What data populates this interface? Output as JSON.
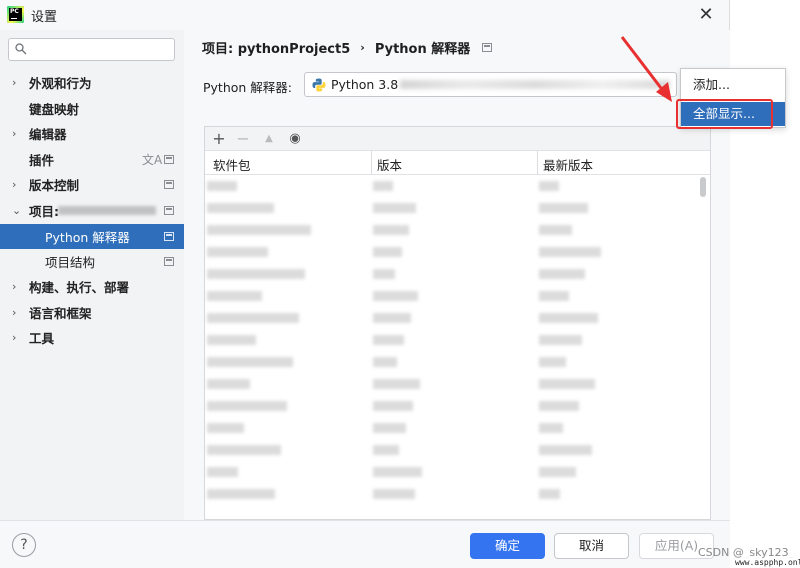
{
  "window": {
    "title": "设置",
    "close_glyph": "✕"
  },
  "search": {
    "placeholder": "",
    "value": ""
  },
  "sidebar": {
    "items": [
      {
        "label": "外观和行为",
        "expandable": true
      },
      {
        "label": "键盘映射",
        "expandable": false
      },
      {
        "label": "编辑器",
        "expandable": true
      },
      {
        "label": "插件",
        "expandable": false
      },
      {
        "label": "版本控制",
        "expandable": true
      },
      {
        "label": "项目:",
        "expandable": true,
        "expanded": true
      },
      {
        "label": "Python 解释器",
        "child": true,
        "selected": true
      },
      {
        "label": "项目结构",
        "child": true
      },
      {
        "label": "构建、执行、部署",
        "expandable": true
      },
      {
        "label": "语言和框架",
        "expandable": true
      },
      {
        "label": "工具",
        "expandable": true
      }
    ]
  },
  "breadcrumb": {
    "project": "项目: pythonProject5",
    "separator": "›",
    "page": "Python 解释器"
  },
  "interpreter": {
    "label": "Python 解释器:",
    "value": "Python 3.8"
  },
  "toolbar": {
    "add": "+",
    "remove": "−",
    "up": "▲",
    "eye": "◉"
  },
  "table": {
    "columns": [
      "软件包",
      "版本",
      "最新版本"
    ]
  },
  "popup": {
    "items": [
      "添加...",
      "全部显示..."
    ],
    "highlighted_index": 1
  },
  "buttons": {
    "help": "?",
    "ok": "确定",
    "cancel": "取消",
    "apply": "应用(A)"
  },
  "watermark": {
    "csdn": "CSDN @_sky123_",
    "site": "www.aspphp.online"
  },
  "colors": {
    "accent": "#2f6eba",
    "primary_button": "#3574f0",
    "highlight_box": "#e83030"
  }
}
